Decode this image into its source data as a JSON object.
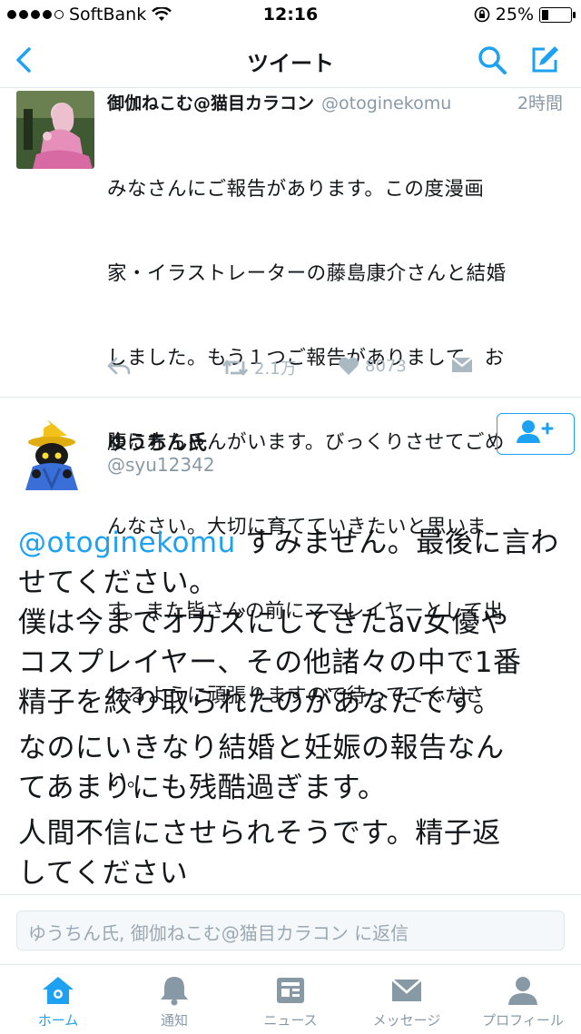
{
  "status_bar": {
    "carrier": "SoftBank",
    "time": "12:16",
    "battery": "25%",
    "signal_bars": 4
  },
  "nav": {
    "title": "ツイート",
    "back_icon": "chevron-left-icon",
    "search_icon": "search-icon",
    "compose_icon": "compose-icon"
  },
  "tweet1": {
    "display_name": "御伽ねこむ@猫目カラコン",
    "handle": "@otoginekomu",
    "time": "2時間",
    "text": "みなさんにご報告があります。この度漫画家・イラストレーターの藤島康介さんと結婚しました。もう１つご報告がありまして、お腹に赤ちゃんがいます。びっくりさせてごめんなさい。大切に育てていきたいと思います。また皆さんの前にママレイヤーとして出れるように頑張りますので待っててください。",
    "lines": [
      "みなさんにご報告があります。この度漫画",
      "家・イラストレーターの藤島康介さんと結婚",
      "しました。もう１つご報告がありまして、お",
      "腹に赤ちゃんがいます。びっくりさせてごめ",
      "んなさい。大切に育てていきたいと思いま",
      "す。また皆さんの前にママレイヤーとして出",
      "れるように頑張りますので待っててくださ",
      "い。"
    ],
    "retweets": "2.1万",
    "likes": "8073"
  },
  "tweet2": {
    "display_name": "ゆうちん氏",
    "handle": "@syu12342",
    "mention": "@otoginekomu",
    "line1_rest": " すみません。最後に言わ",
    "lines": [
      "せてください。",
      "僕は今までオカズにしてきたav女優や",
      "コスプレイヤー、その他諸々の中で1番",
      "精子を絞り取られたのがあなたです。",
      "なのにいきなり結婚と妊娠の報告なん",
      "てあまりにも残酷過ぎます。",
      "人間不信にさせられそうです。精子返",
      "してください"
    ]
  },
  "reply": {
    "placeholder": "ゆうちん氏, 御伽ねこむ@猫目カラコン に返信"
  },
  "tabs": [
    {
      "label": "ホーム",
      "icon": "home-icon",
      "active": true
    },
    {
      "label": "通知",
      "icon": "bell-icon",
      "active": false
    },
    {
      "label": "ニュース",
      "icon": "news-icon",
      "active": false
    },
    {
      "label": "メッセージ",
      "icon": "envelope-icon",
      "active": false
    },
    {
      "label": "プロフィール",
      "icon": "person-icon",
      "active": false
    }
  ],
  "colors": {
    "accent": "#1da1f2",
    "muted": "#8899a6",
    "action_gray": "#aab8c2"
  }
}
